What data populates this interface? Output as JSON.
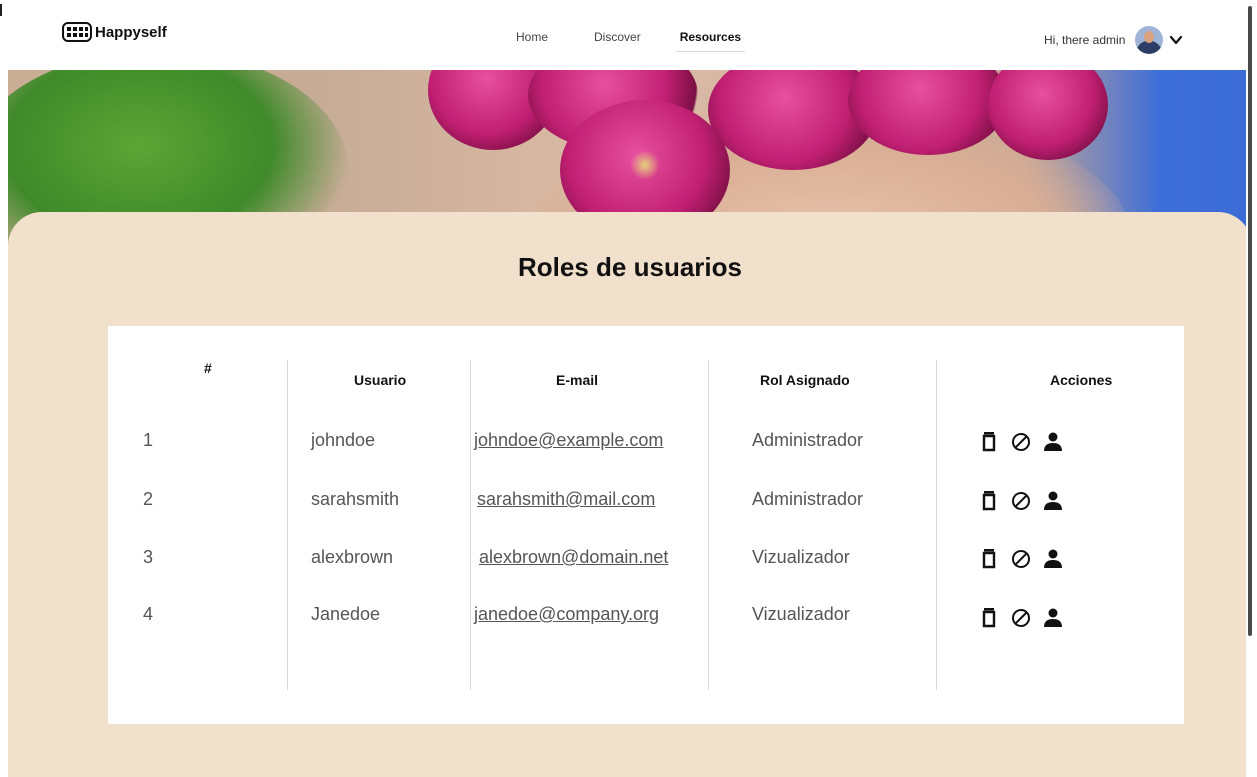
{
  "brand": {
    "name": "Happyself",
    "icon": "grid-logo-icon"
  },
  "nav": {
    "items": [
      "Home",
      "Discover",
      "Resources"
    ],
    "active": "Resources"
  },
  "user": {
    "greeting": "Hi, there admin",
    "avatar_icon": "user-avatar",
    "menu_icon": "chevron-down-icon"
  },
  "page": {
    "title": "Roles de usuarios"
  },
  "table": {
    "headers": [
      "#",
      "Usuario",
      "E-mail",
      "Rol Asignado",
      "Acciones"
    ],
    "rows": [
      {
        "num": "1",
        "user": "johndoe",
        "email": "johndoe@example.com",
        "role": "Administrador"
      },
      {
        "num": "2",
        "user": "sarahsmith",
        "email": "sarahsmith@mail.com",
        "role": "Administrador"
      },
      {
        "num": "3",
        "user": "alexbrown",
        "email": "alexbrown@domain.net",
        "role": "Vizualizador"
      },
      {
        "num": "4",
        "user": "Janedoe",
        "email": "janedoe@company.org",
        "role": "Vizualizador"
      }
    ],
    "action_icons": [
      "trash-icon",
      "block-icon",
      "person-icon"
    ]
  },
  "colors": {
    "section_bg": "#f0e0cc",
    "card_bg": "#ffffff",
    "text_dark": "#111111",
    "text_muted": "#555555"
  }
}
